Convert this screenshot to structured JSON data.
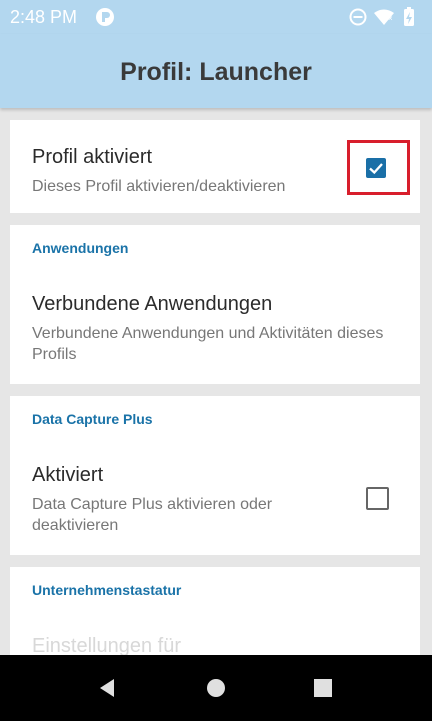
{
  "status_bar": {
    "time": "2:48 PM"
  },
  "app_bar": {
    "title": "Profil: Launcher"
  },
  "profile_enabled": {
    "title": "Profil aktiviert",
    "summary": "Dieses Profil aktivieren/deaktivieren",
    "checked": true
  },
  "applications": {
    "header": "Anwendungen",
    "title": "Verbundene Anwendungen",
    "summary": "Verbundene Anwendungen und Aktivitäten dieses Profils"
  },
  "data_capture_plus": {
    "header": "Data Capture Plus",
    "title": "Aktiviert",
    "summary": "Data Capture Plus aktivieren oder deaktivieren",
    "checked": false
  },
  "enterprise_keyboard": {
    "header": "Unternehmenstastatur",
    "title_partial": "Einstellungen für"
  },
  "colors": {
    "app_bar": "#b3d7ef",
    "section_header": "#1a73a8",
    "checkbox_checked": "#1a6fa7",
    "highlight": "#d81e2c"
  }
}
